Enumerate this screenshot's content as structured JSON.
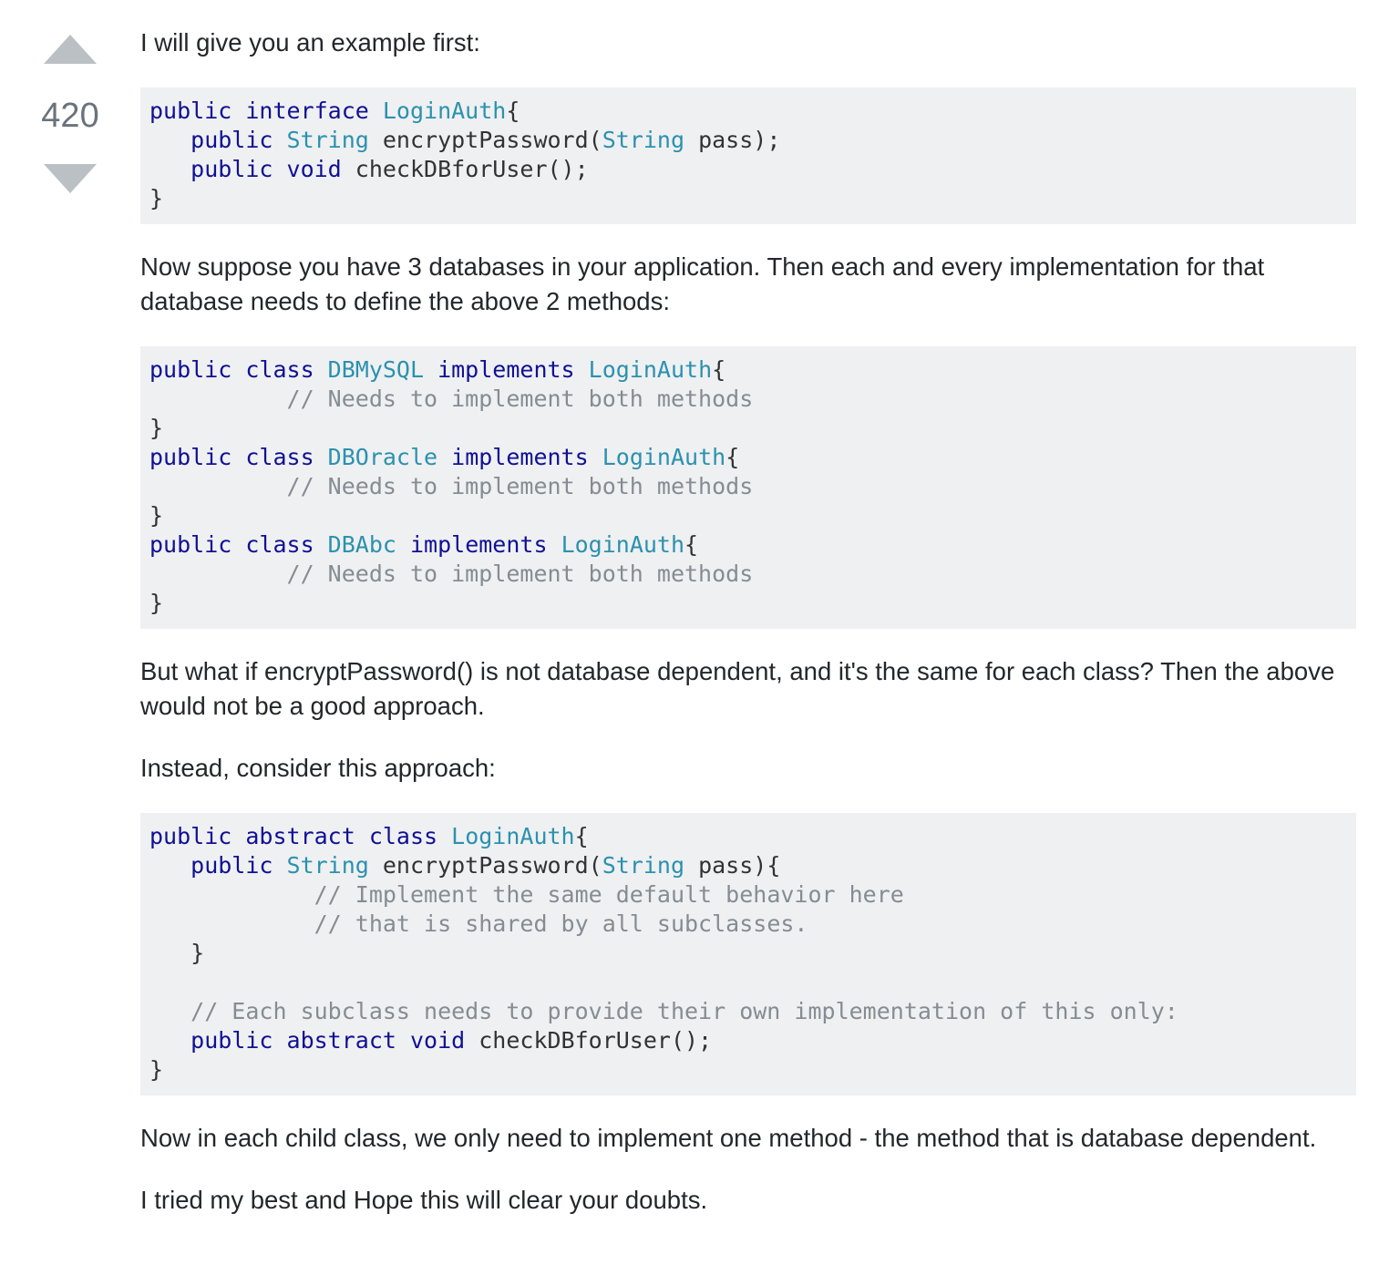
{
  "vote": {
    "count": "420",
    "upvote_icon": "triangle-up",
    "downvote_icon": "triangle-down"
  },
  "answer": {
    "p1": "I will give you an example first:",
    "code1": [
      [
        [
          "kw",
          "public interface "
        ],
        [
          "ty",
          "LoginAuth"
        ],
        [
          "pl",
          "{"
        ]
      ],
      [
        [
          "pl",
          "   "
        ],
        [
          "kw",
          "public "
        ],
        [
          "ty",
          "String"
        ],
        [
          "pl",
          " encryptPassword("
        ],
        [
          "ty",
          "String"
        ],
        [
          "pl",
          " pass);"
        ]
      ],
      [
        [
          "pl",
          "   "
        ],
        [
          "kw",
          "public void "
        ],
        [
          "pl",
          "checkDBforUser();"
        ]
      ],
      [
        [
          "pl",
          "}"
        ]
      ]
    ],
    "p2": "Now suppose you have 3 databases in your application. Then each and every implementation for that database needs to define the above 2 methods:",
    "code2": [
      [
        [
          "kw",
          "public class "
        ],
        [
          "ty",
          "DBMySQL"
        ],
        [
          "kw",
          " implements "
        ],
        [
          "ty",
          "LoginAuth"
        ],
        [
          "pl",
          "{"
        ]
      ],
      [
        [
          "pl",
          "          "
        ],
        [
          "cm",
          "// Needs to implement both methods"
        ]
      ],
      [
        [
          "pl",
          "}"
        ]
      ],
      [
        [
          "kw",
          "public class "
        ],
        [
          "ty",
          "DBOracle"
        ],
        [
          "kw",
          " implements "
        ],
        [
          "ty",
          "LoginAuth"
        ],
        [
          "pl",
          "{"
        ]
      ],
      [
        [
          "pl",
          "          "
        ],
        [
          "cm",
          "// Needs to implement both methods"
        ]
      ],
      [
        [
          "pl",
          "}"
        ]
      ],
      [
        [
          "kw",
          "public class "
        ],
        [
          "ty",
          "DBAbc"
        ],
        [
          "kw",
          " implements "
        ],
        [
          "ty",
          "LoginAuth"
        ],
        [
          "pl",
          "{"
        ]
      ],
      [
        [
          "pl",
          "          "
        ],
        [
          "cm",
          "// Needs to implement both methods"
        ]
      ],
      [
        [
          "pl",
          "}"
        ]
      ]
    ],
    "p3": "But what if encryptPassword() is not database dependent, and it's the same for each class? Then the above would not be a good approach.",
    "p4": "Instead, consider this approach:",
    "code3": [
      [
        [
          "kw",
          "public abstract class "
        ],
        [
          "ty",
          "LoginAuth"
        ],
        [
          "pl",
          "{"
        ]
      ],
      [
        [
          "pl",
          "   "
        ],
        [
          "kw",
          "public "
        ],
        [
          "ty",
          "String"
        ],
        [
          "pl",
          " encryptPassword("
        ],
        [
          "ty",
          "String"
        ],
        [
          "pl",
          " pass){"
        ]
      ],
      [
        [
          "pl",
          "            "
        ],
        [
          "cm",
          "// Implement the same default behavior here"
        ]
      ],
      [
        [
          "pl",
          "            "
        ],
        [
          "cm",
          "// that is shared by all subclasses."
        ]
      ],
      [
        [
          "pl",
          "   }"
        ]
      ],
      [
        [
          "pl",
          ""
        ]
      ],
      [
        [
          "pl",
          "   "
        ],
        [
          "cm",
          "// Each subclass needs to provide their own implementation of this only:"
        ]
      ],
      [
        [
          "pl",
          "   "
        ],
        [
          "kw",
          "public abstract void "
        ],
        [
          "pl",
          "checkDBforUser();"
        ]
      ],
      [
        [
          "pl",
          "}"
        ]
      ]
    ],
    "p5": "Now in each child class, we only need to implement one method - the method that is database dependent.",
    "p6": "I tried my best and Hope this will clear your doubts."
  }
}
